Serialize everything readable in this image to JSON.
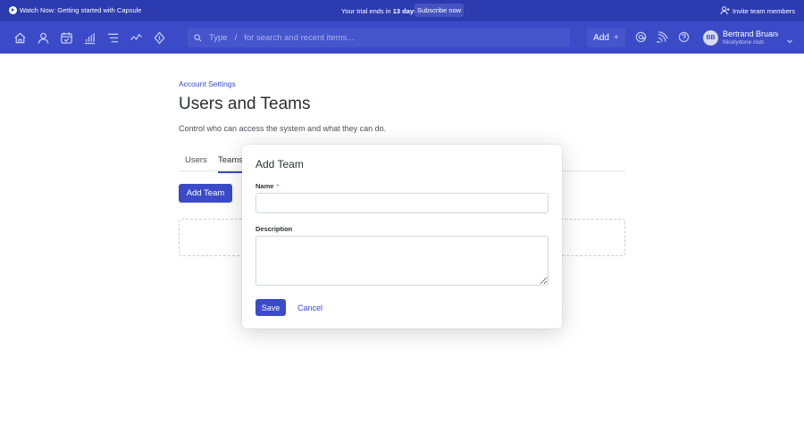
{
  "announcement": {
    "watch_label": "Watch Now: Getting started with Capsule",
    "trial_prefix": "Your trial ends in",
    "trial_days": "13 days",
    "subscribe_label": "Subscribe now",
    "invite_label": "Invite team members"
  },
  "nav": {
    "icons": [
      "home-icon",
      "person-icon",
      "calendar-check-icon",
      "bar-chart-icon",
      "list-icon",
      "activity-icon",
      "lightning-icon"
    ],
    "search": {
      "type_word": "Type",
      "slash": "/",
      "placeholder": "for search and recent items..."
    },
    "add_label": "Add",
    "user": {
      "initials": "BB",
      "name": "Bertrand Bruandet",
      "org": "Nicelydone club"
    }
  },
  "page": {
    "breadcrumb": "Account Settings",
    "title": "Users and Teams",
    "description": "Control who can access the system and what they can do.",
    "tabs": [
      {
        "label": "Users",
        "active": false
      },
      {
        "label": "Teams",
        "active": true
      }
    ],
    "add_team_label": "Add Team"
  },
  "modal": {
    "title": "Add Team",
    "name_label": "Name",
    "required_mark": "*",
    "name_value": "",
    "description_label": "Description",
    "description_value": "",
    "save_label": "Save",
    "cancel_label": "Cancel"
  },
  "colors": {
    "accent": "#3b4bc8",
    "topbar": "#2c3bb0",
    "required": "#e0454a"
  }
}
